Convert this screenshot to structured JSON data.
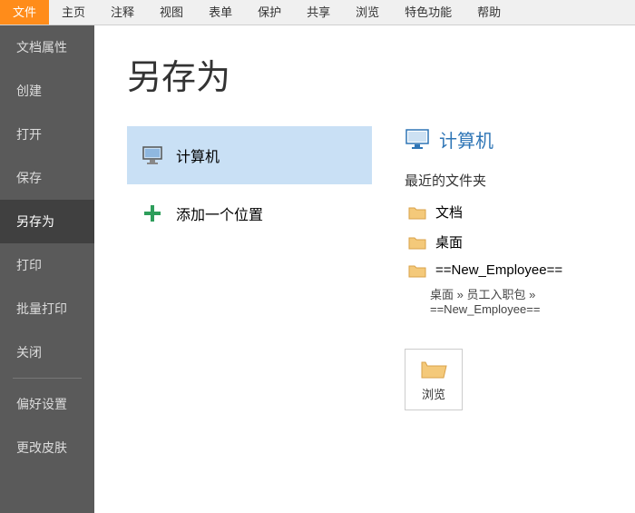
{
  "topMenu": {
    "items": [
      "文件",
      "主页",
      "注释",
      "视图",
      "表单",
      "保护",
      "共享",
      "浏览",
      "特色功能",
      "帮助"
    ],
    "activeIndex": 0
  },
  "sidebar": {
    "items": [
      "文档属性",
      "创建",
      "打开",
      "保存",
      "另存为",
      "打印",
      "批量打印",
      "关闭"
    ],
    "selectedIndex": 4,
    "dividerAfter": 7,
    "extraItems": [
      "偏好设置",
      "更改皮肤"
    ]
  },
  "page": {
    "title": "另存为"
  },
  "locations": {
    "items": [
      {
        "label": "计算机",
        "iconName": "computer-icon"
      },
      {
        "label": "添加一个位置",
        "iconName": "plus-icon"
      }
    ],
    "selectedIndex": 0
  },
  "rightPanel": {
    "heading": "计算机",
    "recentLabel": "最近的文件夹",
    "folders": [
      {
        "name": "文档",
        "path": ""
      },
      {
        "name": "桌面",
        "path": ""
      },
      {
        "name": "==New_Employee==",
        "path": "桌面 » 员工入职包 » ==New_Employee=="
      }
    ],
    "browseLabel": "浏览"
  }
}
